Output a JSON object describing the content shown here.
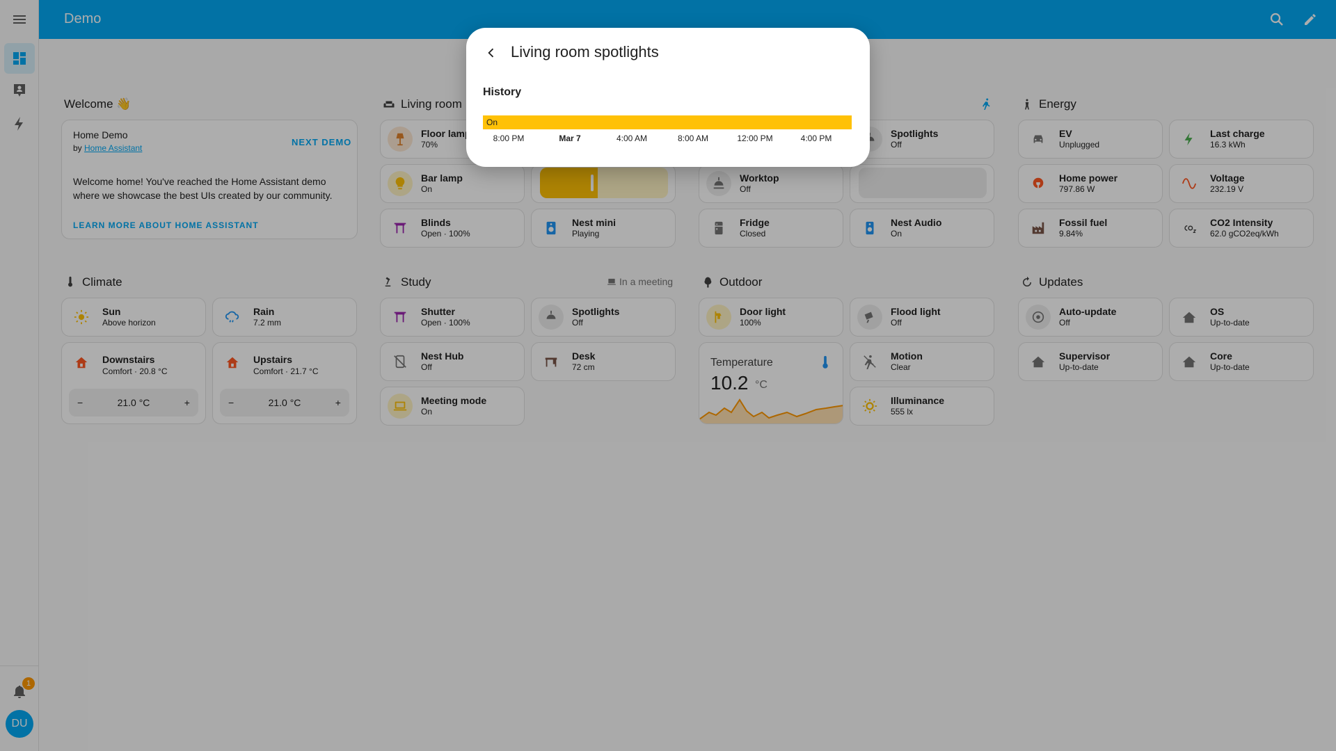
{
  "header": {
    "title": "Demo"
  },
  "sidebar": {
    "notification_count": "1",
    "avatar_initials": "DU"
  },
  "welcome": {
    "title": "Welcome 👋",
    "card_title": "Home Demo",
    "by_prefix": "by ",
    "by_link": "Home Assistant",
    "next_demo": "NEXT DEMO",
    "body": "Welcome home! You've reached the Home Assistant demo where we showcase the best UIs created by our community.",
    "learn_more": "LEARN MORE ABOUT HOME ASSISTANT"
  },
  "living_room": {
    "title": "Living room",
    "floor_lamp": {
      "name": "Floor lamp",
      "state": "70%"
    },
    "bar_lamp": {
      "name": "Bar lamp",
      "state": "On"
    },
    "blinds": {
      "name": "Blinds",
      "state": "Open · 100%"
    },
    "nest_mini": {
      "name": "Nest mini",
      "state": "Playing"
    },
    "slider_level": 0.45
  },
  "kitchen": {
    "spotlights": {
      "name": "Spotlights",
      "state": "Off"
    },
    "worktop": {
      "name": "Worktop",
      "state": "Off"
    },
    "fridge": {
      "name": "Fridge",
      "state": "Closed"
    },
    "nest_audio": {
      "name": "Nest Audio",
      "state": "On"
    }
  },
  "energy": {
    "title": "Energy",
    "ev": {
      "name": "EV",
      "state": "Unplugged"
    },
    "last_charge": {
      "name": "Last charge",
      "state": "16.3 kWh"
    },
    "home_power": {
      "name": "Home power",
      "state": "797.86 W"
    },
    "voltage": {
      "name": "Voltage",
      "state": "232.19 V"
    },
    "fossil_fuel": {
      "name": "Fossil fuel",
      "state": "9.84%"
    },
    "co2": {
      "name": "CO2 Intensity",
      "state": "62.0 gCO2eq/kWh"
    }
  },
  "climate": {
    "title": "Climate",
    "sun": {
      "name": "Sun",
      "state": "Above horizon"
    },
    "rain": {
      "name": "Rain",
      "state": "7.2 mm"
    },
    "downstairs": {
      "name": "Downstairs",
      "state": "Comfort · 20.8 °C",
      "target": "21.0 °C"
    },
    "upstairs": {
      "name": "Upstairs",
      "state": "Comfort · 21.7 °C",
      "target": "21.0 °C"
    },
    "minus": "−",
    "plus": "+"
  },
  "study": {
    "title": "Study",
    "badge": "In a meeting",
    "shutter": {
      "name": "Shutter",
      "state": "Open · 100%"
    },
    "spotlights": {
      "name": "Spotlights",
      "state": "Off"
    },
    "nest_hub": {
      "name": "Nest Hub",
      "state": "Off"
    },
    "desk": {
      "name": "Desk",
      "state": "72 cm"
    },
    "meeting_mode": {
      "name": "Meeting mode",
      "state": "On"
    }
  },
  "outdoor": {
    "title": "Outdoor",
    "door_light": {
      "name": "Door light",
      "state": "100%"
    },
    "flood_light": {
      "name": "Flood light",
      "state": "Off"
    },
    "temperature": {
      "name": "Temperature",
      "value": "10.2",
      "unit": "°C"
    },
    "motion": {
      "name": "Motion",
      "state": "Clear"
    },
    "illuminance": {
      "name": "Illuminance",
      "state": "555 lx"
    }
  },
  "updates": {
    "title": "Updates",
    "auto_update": {
      "name": "Auto-update",
      "state": "Off"
    },
    "os": {
      "name": "OS",
      "state": "Up-to-date"
    },
    "supervisor": {
      "name": "Supervisor",
      "state": "Up-to-date"
    },
    "core": {
      "name": "Core",
      "state": "Up-to-date"
    }
  },
  "dialog": {
    "title": "Living room spotlights",
    "history_label": "History",
    "timeline_state": "On",
    "ticks": [
      "8:00 PM",
      "Mar 7",
      "4:00 AM",
      "8:00 AM",
      "12:00 PM",
      "4:00 PM"
    ]
  },
  "colors": {
    "header": "#03a9f4",
    "light_on": "#ffc107",
    "orange": "#ff9800",
    "purple": "#9c27b0",
    "green": "#4caf50",
    "blue": "#2196f3"
  }
}
